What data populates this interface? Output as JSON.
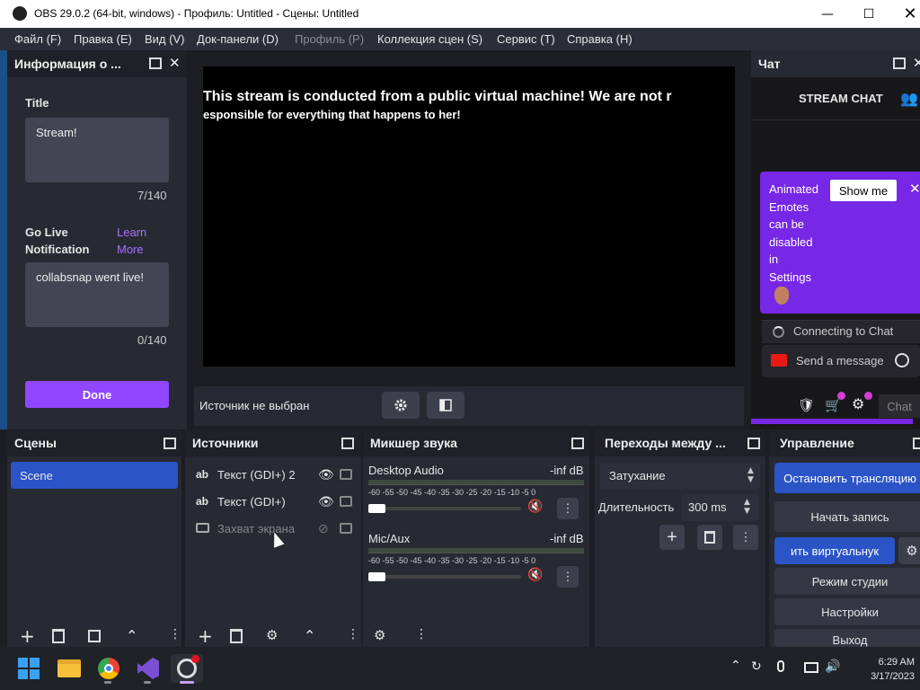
{
  "window": {
    "title": "OBS 29.0.2 (64-bit, windows) - Профиль: Untitled - Сцены: Untitled"
  },
  "menu": [
    "Файл (F)",
    "Правка (E)",
    "Вид (V)",
    "Док-панели (D)",
    "Профиль (P)",
    "Коллекция сцен (S)",
    "Сервис (T)",
    "Справка (H)"
  ],
  "info_dock": {
    "title": "Информация о ...",
    "title_label": "Title",
    "title_value": "Stream!",
    "title_count": "7/140",
    "golive_label_1": "Go Live",
    "golive_label_2": "Notification",
    "learn_1": "Learn",
    "learn_2": "More",
    "golive_value": "collabsnap went live!",
    "golive_count": "0/140",
    "done": "Done"
  },
  "preview": {
    "text_line1": "This stream is conducted from a public virtual machine! We are not r",
    "text_line2": "esponsible for everything that happens to her!",
    "no_source": "Источник не выбран"
  },
  "chat": {
    "title": "Чат",
    "stream_chat": "STREAM CHAT",
    "popup_lines": [
      "Animated",
      "Emotes",
      "can be",
      "disabled",
      "in",
      "Settings"
    ],
    "show_me": "Show me",
    "connecting": "Connecting to Chat",
    "send": "Send a message",
    "chat_button": "Chat"
  },
  "scenes": {
    "title": "Сцены",
    "items": [
      "Scene"
    ]
  },
  "sources": {
    "title": "Источники",
    "items": [
      "Текст (GDI+) 2",
      "Текст (GDI+)",
      "Захват экрана"
    ]
  },
  "mixer": {
    "title": "Микшер звука",
    "ticks": "-60 -55 -50 -45 -40 -35 -30 -25 -20 -15 -10 -5 0",
    "channels": [
      {
        "name": "Desktop Audio",
        "level": "-inf dB"
      },
      {
        "name": "Mic/Aux",
        "level": "-inf dB"
      }
    ]
  },
  "transitions": {
    "title": "Переходы между ...",
    "type": "Затухание",
    "duration_label": "Длительность",
    "duration_value": "300 ms"
  },
  "controls": {
    "title": "Управление",
    "buttons": [
      "Остановить трансляцию",
      "Начать запись",
      "ить виртуальнук",
      "Режим студии",
      "Настройки",
      "Выход"
    ]
  },
  "tray": {
    "time": "6:29 AM",
    "date": "3/17/2023"
  },
  "colors": {
    "accent_purple": "#9147ff",
    "blue_selected": "#2b54c7"
  }
}
